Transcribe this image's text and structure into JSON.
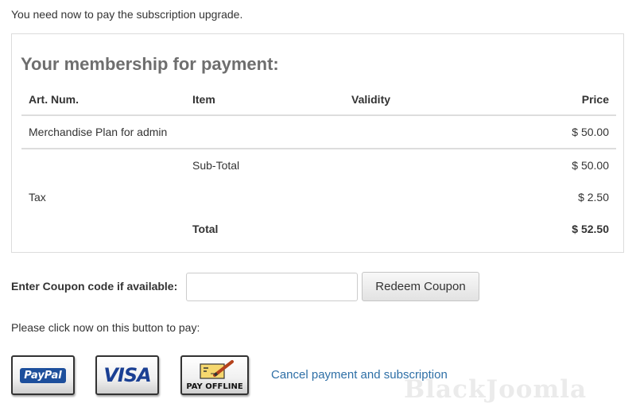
{
  "intro_text": "You need now to pay the subscription upgrade.",
  "panel": {
    "title": "Your membership for payment:",
    "columns": [
      "Art. Num.",
      "Item",
      "Validity",
      "Price"
    ],
    "item_row": {
      "art_num": "Merchandise Plan for admin",
      "item": "",
      "validity": "",
      "price": "$ 50.00"
    },
    "subtotal": {
      "label": "Sub-Total",
      "value": "$ 50.00"
    },
    "tax": {
      "label": "Tax",
      "value": "$ 2.50"
    },
    "total": {
      "label": "Total",
      "value": "$ 52.50"
    }
  },
  "coupon": {
    "label": "Enter Coupon code if available:",
    "input_value": "",
    "button_label": "Redeem Coupon"
  },
  "pay_prompt": "Please click now on this button to pay:",
  "payment_buttons": {
    "paypal_label": "PayPal",
    "visa_label": "VISA",
    "offline_label": "PAY OFFLINE"
  },
  "cancel_link": "Cancel payment and subscription",
  "watermark": "BlackJoomla",
  "colors": {
    "link": "#2e6fa6",
    "title": "#6e6e6e",
    "paypal_blue": "#1d4f9c",
    "visa_blue": "#1a3f93"
  }
}
